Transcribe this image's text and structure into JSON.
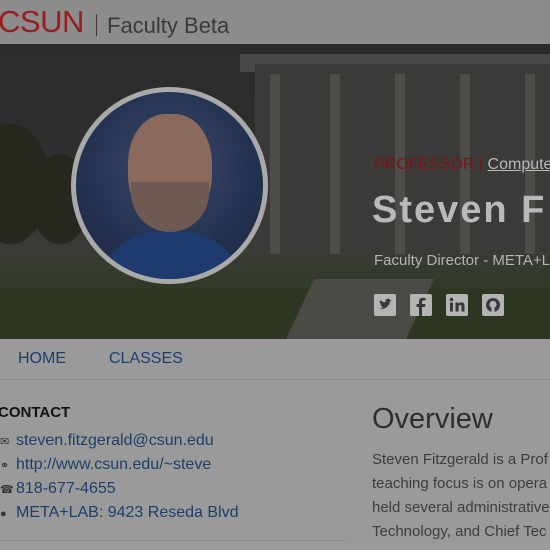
{
  "header": {
    "logo": "CSUN",
    "subtitle": "Faculty Beta"
  },
  "hero": {
    "rank": "PROFESSOR",
    "separator": "|",
    "department": "Compute",
    "name": "Steven F",
    "position": "Faculty Director - META+L",
    "social_icons": [
      "twitter-icon",
      "facebook-icon",
      "linkedin-icon",
      "github-icon"
    ]
  },
  "nav": {
    "items": [
      {
        "label": "HOME"
      },
      {
        "label": "CLASSES"
      }
    ]
  },
  "contact": {
    "title": "CONTACT",
    "items": [
      {
        "icon": "mail-icon",
        "text": "steven.fitzgerald@csun.edu"
      },
      {
        "icon": "link-icon",
        "text": "http://www.csun.edu/~steve"
      },
      {
        "icon": "phone-icon",
        "text": "818-677-4655"
      },
      {
        "icon": "location-icon",
        "text": "META+LAB: 9423 Reseda Blvd"
      }
    ]
  },
  "overview": {
    "title": "Overview",
    "lines": [
      "Steven Fitzgerald is a Prof",
      "teaching focus is on opera",
      "held several administrative",
      "Technology, and Chief Tec"
    ]
  },
  "colors": {
    "brand_red": "#9b1b1e",
    "link_blue": "#1c3f6a"
  }
}
